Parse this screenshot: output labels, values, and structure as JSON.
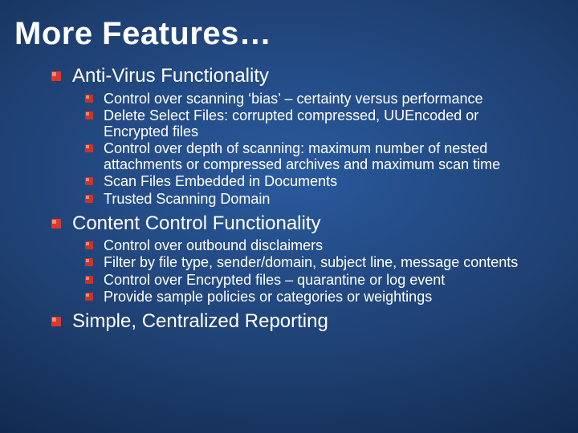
{
  "title": "More Features…",
  "sections": [
    {
      "heading": "Anti-Virus Functionality",
      "items": [
        "Control over scanning ‘bias’ – certainty versus performance",
        "Delete Select Files: corrupted compressed, UUEncoded or Encrypted files",
        "Control over depth of scanning: maximum number of nested attachments or compressed archives and maximum scan time",
        "Scan Files Embedded in Documents",
        "Trusted Scanning Domain"
      ]
    },
    {
      "heading": "Content Control Functionality",
      "items": [
        "Control over outbound disclaimers",
        "Filter by file type, sender/domain, subject line, message contents",
        "Control over Encrypted files – quarantine or log event",
        "Provide sample policies or categories or weightings"
      ]
    },
    {
      "heading": "Simple, Centralized Reporting",
      "items": []
    }
  ],
  "colors": {
    "bullet1_fill": "#d93a2b",
    "bullet1_highlight": "#f58f7a",
    "bullet2_fill": "#c8362a",
    "bullet2_highlight": "#e88a78"
  }
}
